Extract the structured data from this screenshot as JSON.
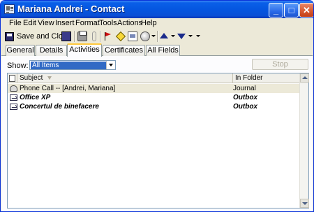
{
  "window": {
    "title": "Mariana Andrei - Contact"
  },
  "menu": [
    "File",
    "Edit",
    "View",
    "Insert",
    "Format",
    "Tools",
    "Actions",
    "Help"
  ],
  "toolbar": {
    "save_close_label": "Save and Close",
    "icons": [
      "save-icon",
      "print-icon",
      "attach-icon",
      "flag-icon",
      "diamond-icon",
      "card-icon",
      "globe-icon",
      "arrow-up-icon",
      "arrow-down-icon"
    ]
  },
  "tabs": [
    {
      "label": "General",
      "active": false
    },
    {
      "label": "Details",
      "active": false
    },
    {
      "label": "Activities",
      "active": true
    },
    {
      "label": "Certificates",
      "active": false
    },
    {
      "label": "All Fields",
      "active": false
    }
  ],
  "activities": {
    "show_label": "Show:",
    "show_value": "All Items",
    "stop_label": "Stop",
    "columns": [
      "Subject",
      "In Folder"
    ],
    "rows": [
      {
        "icon": "phone-icon",
        "subject": "Phone Call -- [Andrei, Mariana]",
        "folder": "Journal",
        "bold": false,
        "selected": true
      },
      {
        "icon": "mail-icon",
        "subject": "Office XP",
        "folder": "Outbox",
        "bold": true,
        "selected": false
      },
      {
        "icon": "mail-icon",
        "subject": "Concertul de binefacere",
        "folder": "Outbox",
        "bold": true,
        "selected": false
      }
    ]
  },
  "colors": {
    "titlebar": "#0556e0",
    "selection": "#316ac5",
    "active_tab_accent": "#ffc83c"
  }
}
